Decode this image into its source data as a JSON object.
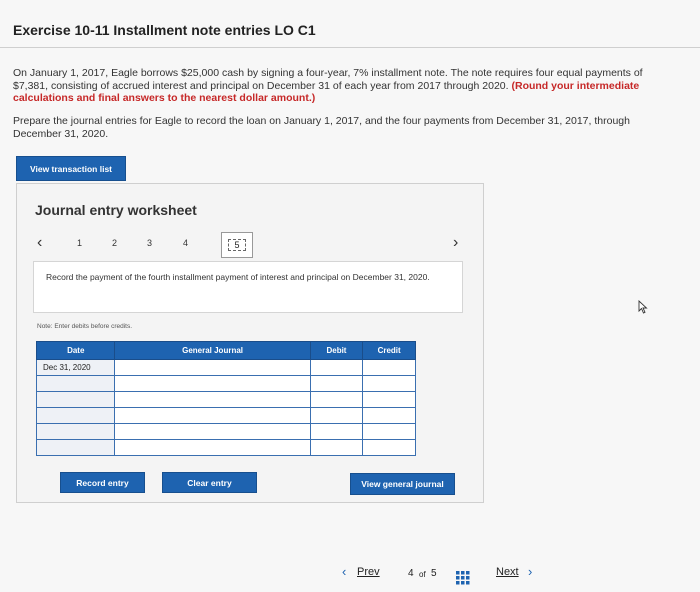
{
  "header": {
    "title": "Exercise 10-11 Installment note entries LO C1"
  },
  "problem": {
    "paragraph1_normal": "On January 1, 2017, Eagle borrows $25,000 cash by signing a four-year, 7% installment note. The note requires four equal payments of $7,381, consisting of accrued interest and principal on December 31 of each year from 2017 through 2020.",
    "paragraph1_red": "(Round your intermediate calculations and final answers to the nearest dollar amount.)",
    "paragraph2": "Prepare the journal entries for Eagle to record the loan on January 1, 2017, and the four payments from December 31, 2017, through December 31, 2020."
  },
  "buttons": {
    "view_transaction_list": "View transaction list",
    "record_entry": "Record entry",
    "clear_entry": "Clear entry",
    "view_general_journal": "View general journal"
  },
  "worksheet": {
    "title": "Journal entry worksheet",
    "pages": [
      "1",
      "2",
      "3",
      "4",
      "5"
    ],
    "current_page": "5",
    "instruction": "Record the payment of the fourth installment payment of interest and principal on December 31, 2020.",
    "note": "Note: Enter debits before credits.",
    "columns": {
      "date": "Date",
      "general_journal": "General Journal",
      "debit": "Debit",
      "credit": "Credit"
    },
    "rows": [
      {
        "date": "Dec 31, 2020",
        "account": "",
        "debit": "",
        "credit": ""
      },
      {
        "date": "",
        "account": "",
        "debit": "",
        "credit": ""
      },
      {
        "date": "",
        "account": "",
        "debit": "",
        "credit": ""
      },
      {
        "date": "",
        "account": "",
        "debit": "",
        "credit": ""
      },
      {
        "date": "",
        "account": "",
        "debit": "",
        "credit": ""
      },
      {
        "date": "",
        "account": "",
        "debit": "",
        "credit": ""
      }
    ]
  },
  "footer": {
    "prev_label": "Prev",
    "page_current": "4",
    "page_of": "of",
    "page_total": "5",
    "next_label": "Next"
  },
  "colors": {
    "primary_button": "#1e63b0",
    "highlight_red": "#c62828"
  }
}
